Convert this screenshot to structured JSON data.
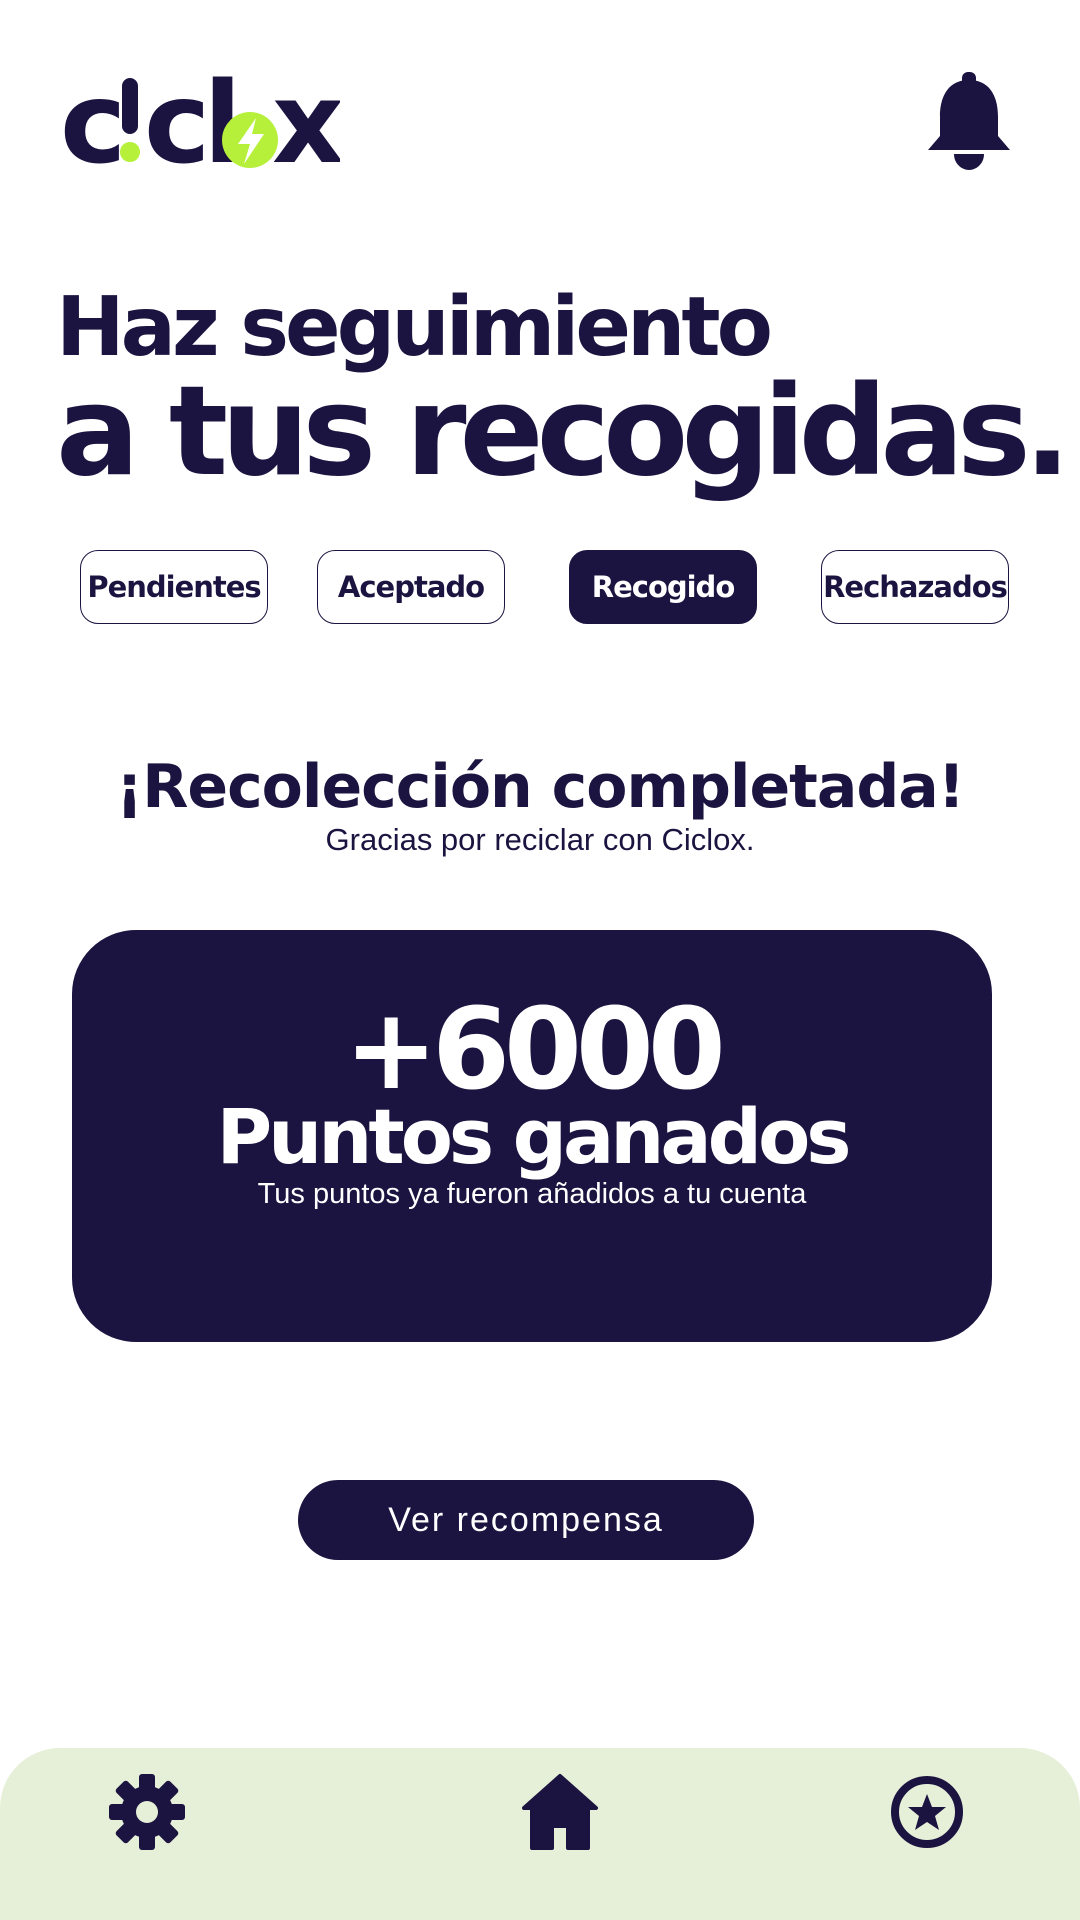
{
  "header": {
    "logo_text": "ciclox",
    "notifications_icon": "bell-icon"
  },
  "hero": {
    "line1": "Haz seguimiento",
    "line2": "a tus recogidas."
  },
  "tabs": [
    {
      "label": "Pendientes",
      "active": false
    },
    {
      "label": "Aceptado",
      "active": false
    },
    {
      "label": "Recogido",
      "active": true
    },
    {
      "label": "Rechazados",
      "active": false
    }
  ],
  "status": {
    "title": "¡Recolección completada!",
    "subtitle": "Gracias por reciclar con Ciclox."
  },
  "points_card": {
    "points": "+6000",
    "label": "Puntos ganados",
    "note": "Tus puntos ya fueron añadidos a tu cuenta"
  },
  "actions": {
    "reward_button": "Ver recompensa"
  },
  "bottom_nav": [
    {
      "icon": "gear-icon"
    },
    {
      "icon": "home-icon"
    },
    {
      "icon": "star-circle-icon"
    }
  ],
  "colors": {
    "primary": "#1b1440",
    "accent": "#b6f03a",
    "nav_background": "#e6f0d8"
  }
}
